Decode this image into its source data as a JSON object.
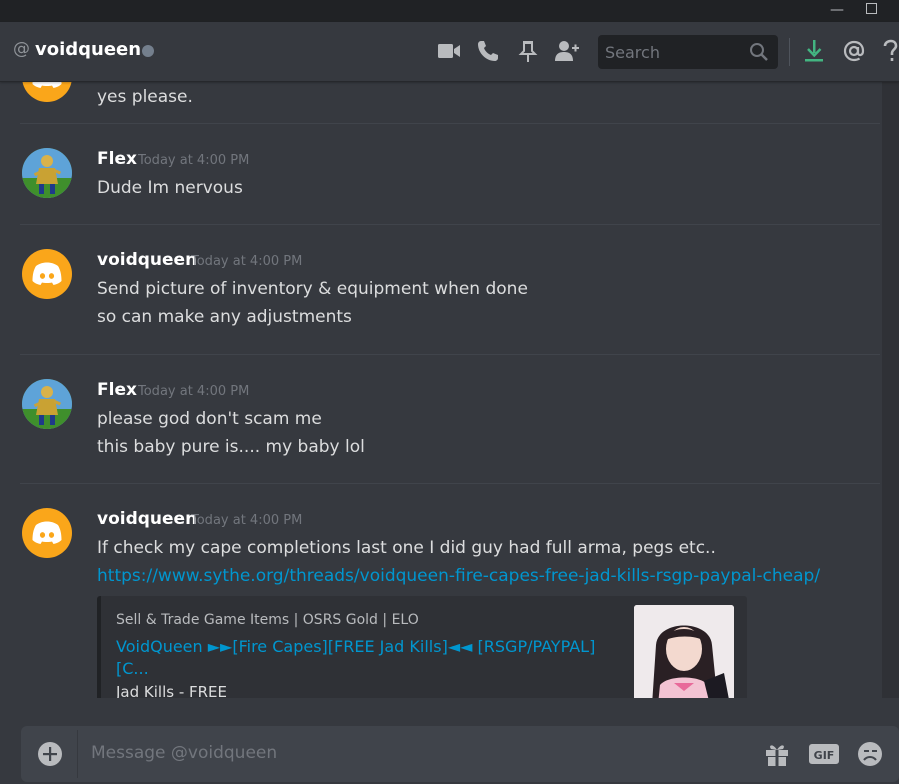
{
  "window": {
    "minimize_glyph": "—",
    "maximize_glyph": ""
  },
  "header": {
    "at_symbol": "@",
    "title": "voidqueen",
    "status_color": "#747f8d",
    "icons": [
      "video-call-icon",
      "voice-call-icon",
      "pin-icon",
      "add-friend-icon"
    ],
    "search_placeholder": "Search",
    "right_icons": [
      "download-icon",
      "mentions-icon",
      "help-icon"
    ]
  },
  "messages": [
    {
      "author": "",
      "avatar": "discord-logo-avatar",
      "timestamp": "",
      "lines": [
        "yes please."
      ]
    },
    {
      "author": "Flex",
      "avatar": "runescape-character-avatar",
      "timestamp": "Today at 4:00 PM",
      "lines": [
        "Dude Im nervous"
      ]
    },
    {
      "author": "voidqueen",
      "avatar": "discord-logo-avatar",
      "timestamp": "Today at 4:00 PM",
      "lines": [
        "Send picture of inventory & equipment when done",
        "so can make any adjustments"
      ]
    },
    {
      "author": "Flex",
      "avatar": "runescape-character-avatar",
      "timestamp": "Today at 4:00 PM",
      "lines": [
        "please god don't scam me",
        "this baby pure is.... my baby lol"
      ]
    },
    {
      "author": "voidqueen",
      "avatar": "discord-logo-avatar",
      "timestamp": "Today at 4:00 PM",
      "lines": [
        "If check my cape completions last one I did guy had full arma, pegs etc.."
      ],
      "link": "https://www.sythe.org/threads/voidqueen-fire-capes-free-jad-kills-rsgp-paypal-cheap/",
      "embed": {
        "provider": "Sell & Trade Game Items | OSRS Gold | ELO",
        "title_line1": "VoidQueen ►►[Fire Capes][FREE Jad Kills]◄◄ [RSGP/PAYPAL]",
        "title_line2": "[C...",
        "description": "Jad Kills - FREE",
        "thumbnail": "profile-photo-thumbnail"
      }
    }
  ],
  "composer": {
    "placeholder": "Message @voidqueen",
    "icons": [
      "gift-icon",
      "gif-icon",
      "emoji-icon"
    ],
    "gif_label": "GIF"
  },
  "colors": {
    "background": "#36393f",
    "link": "#0096cf",
    "discord_orange": "#faa61a",
    "download_green": "#43b581"
  }
}
